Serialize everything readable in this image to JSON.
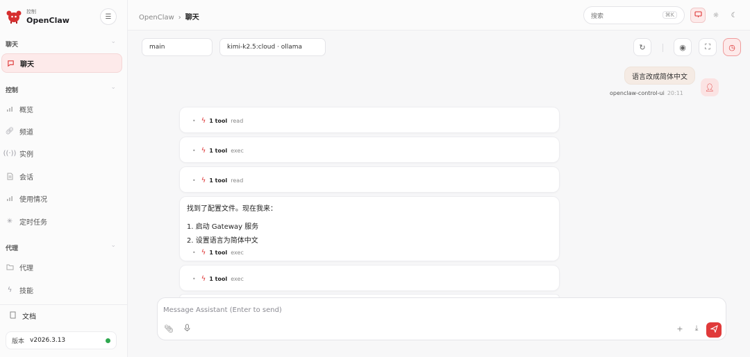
{
  "brand": {
    "small": "控制",
    "name": "OpenClaw"
  },
  "sidebar": {
    "sections": [
      {
        "title": "聊天"
      },
      {
        "title": "控制"
      },
      {
        "title": "代理"
      }
    ],
    "chat_items": [
      {
        "label": "聊天",
        "icon": "chat-icon"
      }
    ],
    "control_items": [
      {
        "label": "概览",
        "icon": "bar-chart-icon"
      },
      {
        "label": "频道",
        "icon": "link-icon"
      },
      {
        "label": "实例",
        "icon": "broadcast-icon"
      },
      {
        "label": "会话",
        "icon": "document-icon"
      },
      {
        "label": "使用情况",
        "icon": "bar-chart-icon"
      },
      {
        "label": "定时任务",
        "icon": "loader-icon"
      }
    ],
    "agent_items": [
      {
        "label": "代理",
        "icon": "folder-icon"
      },
      {
        "label": "技能",
        "icon": "bolt-icon"
      }
    ],
    "docs_label": "文档",
    "version_label": "版本",
    "version_value": "v2026.3.13",
    "status_color": "#2fa84f"
  },
  "topbar": {
    "breadcrumb_root": "OpenClaw",
    "breadcrumb_sep": "›",
    "breadcrumb_current": "聊天",
    "search_placeholder": "搜索",
    "search_shortcut": "⌘K"
  },
  "main": {
    "session": "main",
    "model": "kimi-k2.5:cloud · ollama",
    "user_message": "语言改成简体中文",
    "user_name": "openclaw-control-ui",
    "user_time": "20:11",
    "tool_calls": [
      {
        "count": "1 tool",
        "name": "read"
      },
      {
        "count": "1 tool",
        "name": "exec"
      },
      {
        "count": "1 tool",
        "name": "read"
      },
      {
        "count": "1 tool",
        "name": "exec"
      },
      {
        "count": "1 tool",
        "name": "exec"
      }
    ],
    "assistant_text": "找到了配置文件。现在我来：",
    "steps": [
      "1. 启动 Gateway 服务",
      "2. 设置语言为简体中文"
    ]
  },
  "composer": {
    "placeholder": "Message Assistant (Enter to send)"
  },
  "colors": {
    "accent": "#e03a3a",
    "active_bg": "#fdeaea"
  }
}
